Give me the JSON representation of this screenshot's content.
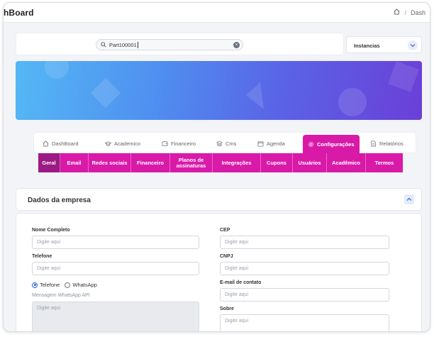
{
  "topbar": {
    "title": "hBoard",
    "breadcrumb_sep": "/",
    "breadcrumb_current": "Dash"
  },
  "search": {
    "value": "Part100001"
  },
  "instancias": {
    "label": "Instancias"
  },
  "tabs": [
    {
      "label": "DashBoard",
      "icon": "home-icon"
    },
    {
      "label": "Academico",
      "icon": "graduation-cap-icon"
    },
    {
      "label": "Financeiro",
      "icon": "wallet-icon"
    },
    {
      "label": "Cms",
      "icon": "layers-icon"
    },
    {
      "label": "Agenda",
      "icon": "calendar-icon"
    },
    {
      "label": "Configurações",
      "icon": "gear-icon"
    },
    {
      "label": "Relatórios",
      "icon": "document-icon"
    }
  ],
  "subtabs": [
    {
      "label": "Geral"
    },
    {
      "label": "Email"
    },
    {
      "label": "Redes sociais"
    },
    {
      "label": "Financeiro"
    },
    {
      "label": "Planos de assinaturas"
    },
    {
      "label": "Integrações"
    },
    {
      "label": "Cupons"
    },
    {
      "label": "Usuários"
    },
    {
      "label": "Acadêmico"
    },
    {
      "label": "Termos"
    }
  ],
  "section": {
    "title": "Dados da empresa"
  },
  "form": {
    "nome": {
      "label": "Nome Completo",
      "placeholder": "Digite aqui"
    },
    "telefone": {
      "label": "Telefone",
      "placeholder": "Digite aqui"
    },
    "radio_telefone": "Telefone",
    "radio_whatsapp": "WhatsApp",
    "mensagem": {
      "label": "Mensagem WhatsApp API",
      "placeholder": "Digite aqui"
    },
    "cep": {
      "label": "CEP",
      "placeholder": "Digite aqui"
    },
    "cnpj": {
      "label": "CNPJ",
      "placeholder": "Digite aqui"
    },
    "email": {
      "label": "E-mail de contato",
      "placeholder": "Digite aqui"
    },
    "sobre": {
      "label": "Sobre",
      "placeholder": "Digite aqui"
    }
  },
  "colors": {
    "accent": "#d91aa8",
    "accent_dark": "#9c1a84",
    "banner_start": "#55b8f5",
    "banner_end": "#6b3fd8"
  }
}
